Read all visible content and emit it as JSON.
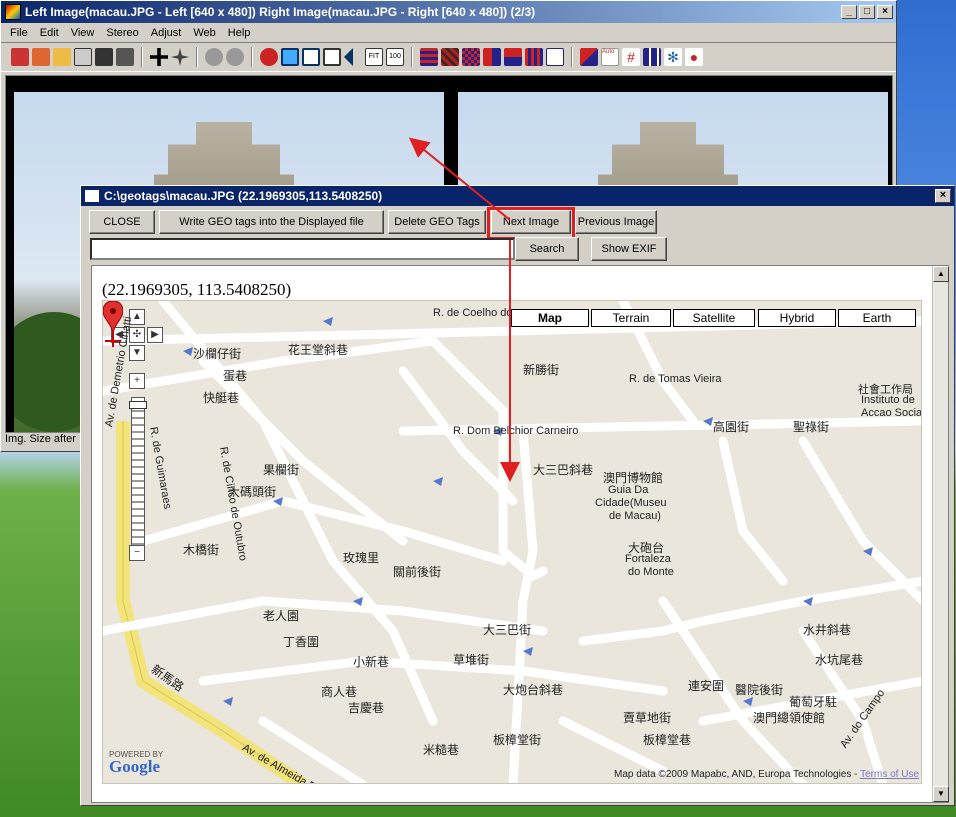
{
  "main_window": {
    "title": "Left Image(macau.JPG - Left [640 x 480]) Right Image(macau.JPG - Right [640 x 480])  (2/3)",
    "menu": [
      "File",
      "Edit",
      "View",
      "Stereo",
      "Adjust",
      "Web",
      "Help"
    ],
    "status": "Img. Size after"
  },
  "dialog": {
    "title": "C:\\geotags\\macau.JPG (22.1969305,113.5408250)",
    "buttons": {
      "close": "CLOSE",
      "write_geo": "Write GEO tags into the Displayed file",
      "delete_geo": "Delete GEO Tags",
      "next_image": "Next Image",
      "previous_image": "Previous Image",
      "search": "Search",
      "show_exif": "Show EXIF"
    },
    "search_value": "",
    "coords": "(22.1969305, 113.5408250)"
  },
  "map": {
    "types": [
      "Map",
      "Terrain",
      "Satellite",
      "Hybrid",
      "Earth"
    ],
    "active_type": "Map",
    "streets": [
      "R. de Coelho do",
      "花王堂斜巷",
      "沙欄仔街",
      "蛋巷",
      "快艇巷",
      "R. de Guimaraes",
      "R. de Tomas Vieira",
      "新勝街",
      "社會工作局",
      "Instituto de",
      "Accao Social",
      "R. Dom Belchior Carneiro",
      "高園街",
      "聖祿街",
      "大三巴斜巷",
      "澳門博物館",
      "Guia Da",
      "Cidade(Museu",
      "de Macau)",
      "大砲台",
      "Fortaleza",
      "do Monte",
      "R. de Cinco de Outubro",
      "果欄街",
      "大碼頭街",
      "玫瑰里",
      "關前後街",
      "草堆街",
      "木橋街",
      "老人園",
      "丁香圍",
      "小新巷",
      "商人巷",
      "吉慶巷",
      "大三巴街",
      "大炮台斜巷",
      "水井斜巷",
      "水坑尾巷",
      "葡萄牙駐",
      "澳門總領使館",
      "板樟堂街",
      "米糙巷",
      "賣草地街",
      "連安圍",
      "板樟堂巷",
      "醫院後街",
      "新馬路",
      "Av. de Almeida Ribeiro",
      "Av. do Campo",
      "Av. de Demetrio Cinatti"
    ],
    "attribution": "Map data ©2009 Mapabc, AND, Europa Technologies -",
    "terms": "Terms of Use",
    "powered_by": "POWERED BY",
    "google": "Google"
  }
}
